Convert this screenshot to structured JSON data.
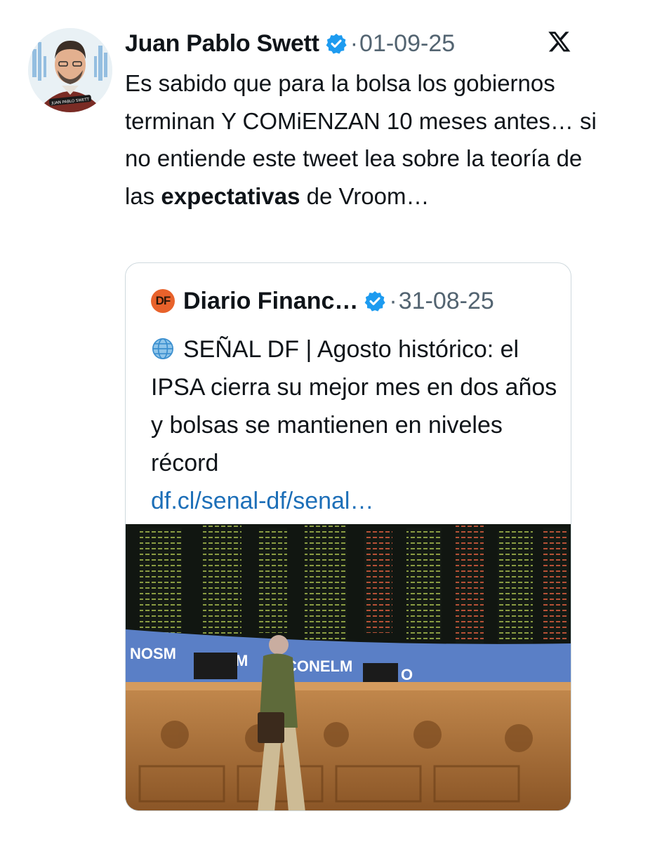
{
  "tweet": {
    "author_name": "Juan Pablo Swett",
    "separator": "·",
    "date": "01-09-25",
    "text_before_bold": "Es sabido que para la bolsa los gobiernos terminan Y COMiENZAN 10 meses antes… si no entiende este tweet  lea sobre la teoría de las ",
    "text_bold": "expectativas",
    "text_after_bold": " de Vroom…",
    "avatar_caption": "JUAN PABLO SWETT",
    "icons": {
      "verified": "verified-badge-icon",
      "platform": "x-logo-icon"
    },
    "colors": {
      "verified": "#1d9bf0",
      "link": "#1d6fb8",
      "muted": "#536471"
    }
  },
  "quoted": {
    "source_logo": "DF",
    "source_name": "Diario Financ…",
    "separator": "·",
    "date": "31-08-25",
    "headline": "SEÑAL DF | Agosto histórico: el IPSA cierra su mejor mes en dos años y bolsas se mantienen en niveles récord",
    "link": "df.cl/senal-df/senal…",
    "image": {
      "banner_text_left": "NOSM",
      "banner_text_mid": "M",
      "banner_text_right": "CONELM",
      "banner_text_end": "O"
    },
    "icons": {
      "globe": "globe-icon",
      "verified": "verified-badge-icon"
    },
    "colors": {
      "logo_bg": "#e8622b"
    }
  }
}
